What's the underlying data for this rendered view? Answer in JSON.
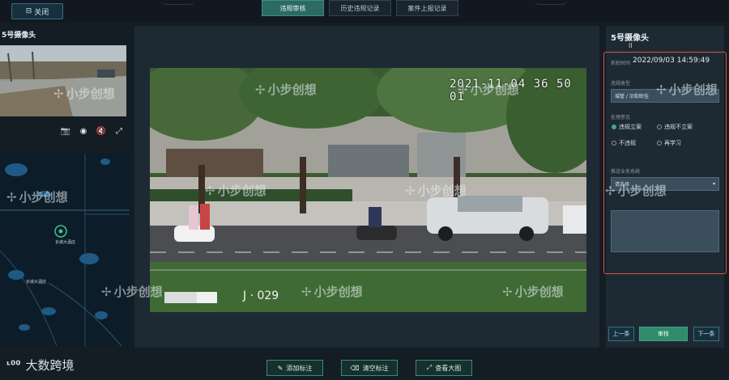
{
  "header": {
    "back_label": "关闭",
    "tabs": [
      {
        "label": "违规审核",
        "active": true
      },
      {
        "label": "历史违规记录",
        "active": false
      },
      {
        "label": "案件上报记录",
        "active": false
      }
    ]
  },
  "left": {
    "camera_title": "5号摄像头",
    "map_label": "长城大酒店"
  },
  "video": {
    "timestamp": "2021-11-04 36 50 01",
    "plate_text": "J · 029"
  },
  "center_actions": {
    "add_label": "添加标注",
    "clear_label": "清空标注",
    "view_large": "查看大图"
  },
  "right": {
    "title": "5号摄像头",
    "subtitle": "II",
    "capture_time_label": "抓拍时间",
    "capture_time": "2022/09/03 14:59:49",
    "violation_type_label": "违规类型",
    "violation_type_value": "城管 / 沿街晾挂",
    "handling_label": "处理意见",
    "options": [
      {
        "label": "违规立案",
        "checked": true
      },
      {
        "label": "违规不立案",
        "checked": false
      },
      {
        "label": "不违规",
        "checked": false
      },
      {
        "label": "再学习",
        "checked": false
      }
    ],
    "system_label": "推送业务系统",
    "system_placeholder": "请选择",
    "prev_label": "上一条",
    "review_label": "审核",
    "next_label": "下一条"
  },
  "watermark_text": "小步创想",
  "brand_text": "大数跨境",
  "colors": {
    "accent_teal": "#2f8b6b",
    "highlight_red": "#e2513b",
    "background": "#141c24"
  }
}
